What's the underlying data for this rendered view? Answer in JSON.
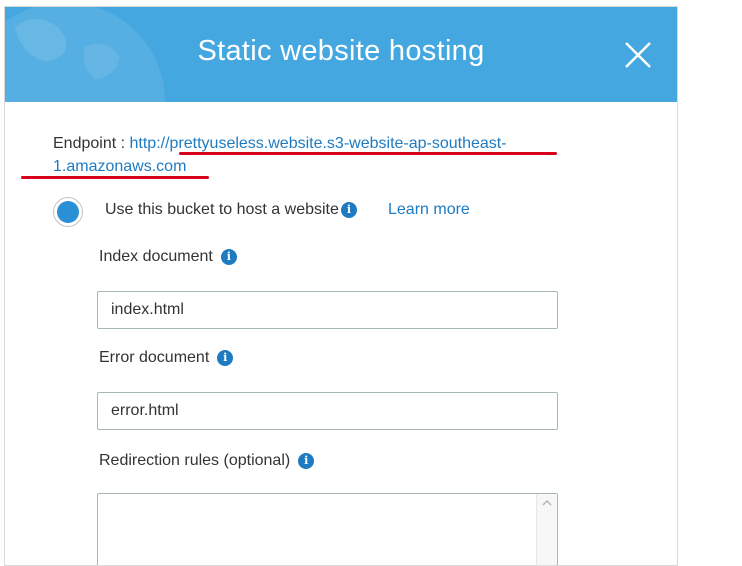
{
  "dialog": {
    "title": "Static website hosting",
    "close_label": "close"
  },
  "endpoint": {
    "label": "Endpoint : ",
    "url": "http://prettyuseless.website.s3-website-ap-southeast-1.amazonaws.com",
    "url_line1": "http://prettyuseless.website.s3-website-ap-southeast-",
    "url_line2": "1.amazonaws.com"
  },
  "hosting_option": {
    "label": "Use this bucket to host a website",
    "selected": true,
    "learn_more": "Learn more"
  },
  "index_document": {
    "label": "Index document",
    "value": "index.html"
  },
  "error_document": {
    "label": "Error document",
    "value": "error.html"
  },
  "redirection_rules": {
    "label": "Redirection rules (optional)",
    "value": ""
  },
  "colors": {
    "header": "#45a7df",
    "link": "#1e7bc2",
    "radio_selected": "#2b8fd6",
    "annotation": "#d9001e"
  },
  "icons": {
    "info": "info-icon",
    "close": "close-icon",
    "globe": "globe-decoration"
  }
}
